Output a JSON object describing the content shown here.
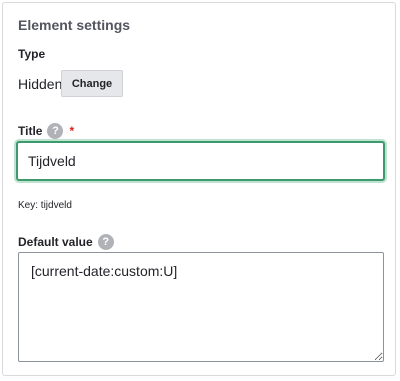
{
  "section": {
    "title": "Element settings"
  },
  "type": {
    "label": "Type",
    "value": "Hidden",
    "change_button": "Change"
  },
  "title_field": {
    "label": "Title",
    "help_icon": "?",
    "required_mark": "*",
    "value": "Tijdveld"
  },
  "key": {
    "text": "Key: tijdveld"
  },
  "default_value": {
    "label": "Default value",
    "help_icon": "?",
    "value": "[current-date:custom:U]"
  },
  "colors": {
    "focus_border": "#3c9a6e",
    "required": "#d72222"
  }
}
